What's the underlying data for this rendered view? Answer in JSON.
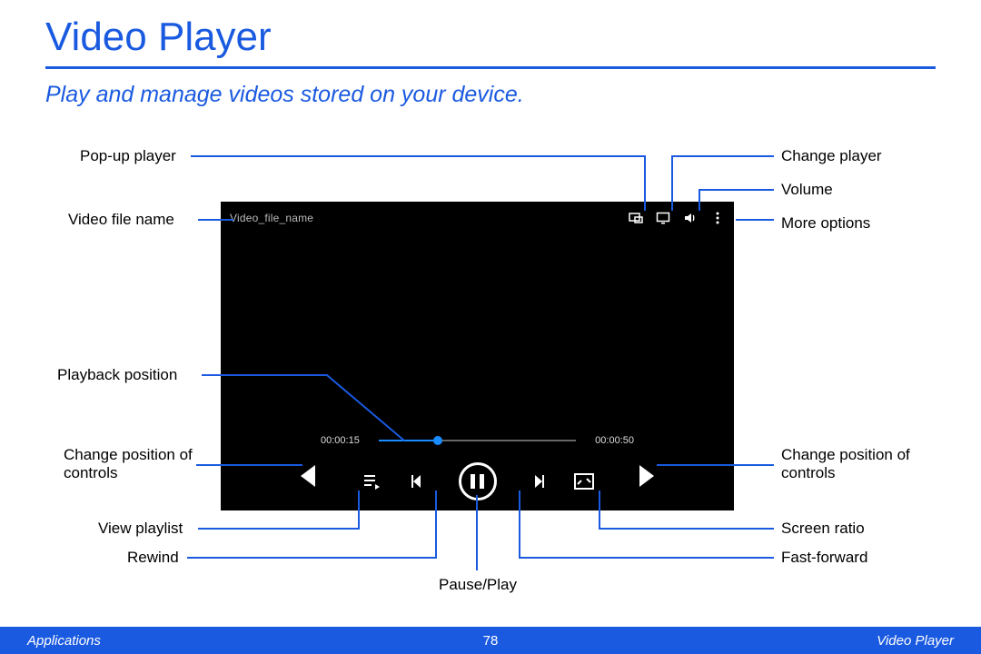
{
  "title": "Video Player",
  "subtitle": "Play and manage videos stored on your device.",
  "player": {
    "filename": "Video_file_name",
    "elapsed": "00:00:15",
    "total": "00:00:50"
  },
  "labels": {
    "popup_player": "Pop-up player",
    "video_file_name": "Video file name",
    "playback_position": "Playback position",
    "change_position_left": "Change position of controls",
    "view_playlist": "View playlist",
    "rewind": "Rewind",
    "pause_play": "Pause/Play",
    "change_player": "Change player",
    "volume": "Volume",
    "more_options": "More options",
    "change_position_right": "Change position of controls",
    "screen_ratio": "Screen ratio",
    "fast_forward": "Fast-forward"
  },
  "footer": {
    "left": "Applications",
    "page": "78",
    "right": "Video Player"
  }
}
